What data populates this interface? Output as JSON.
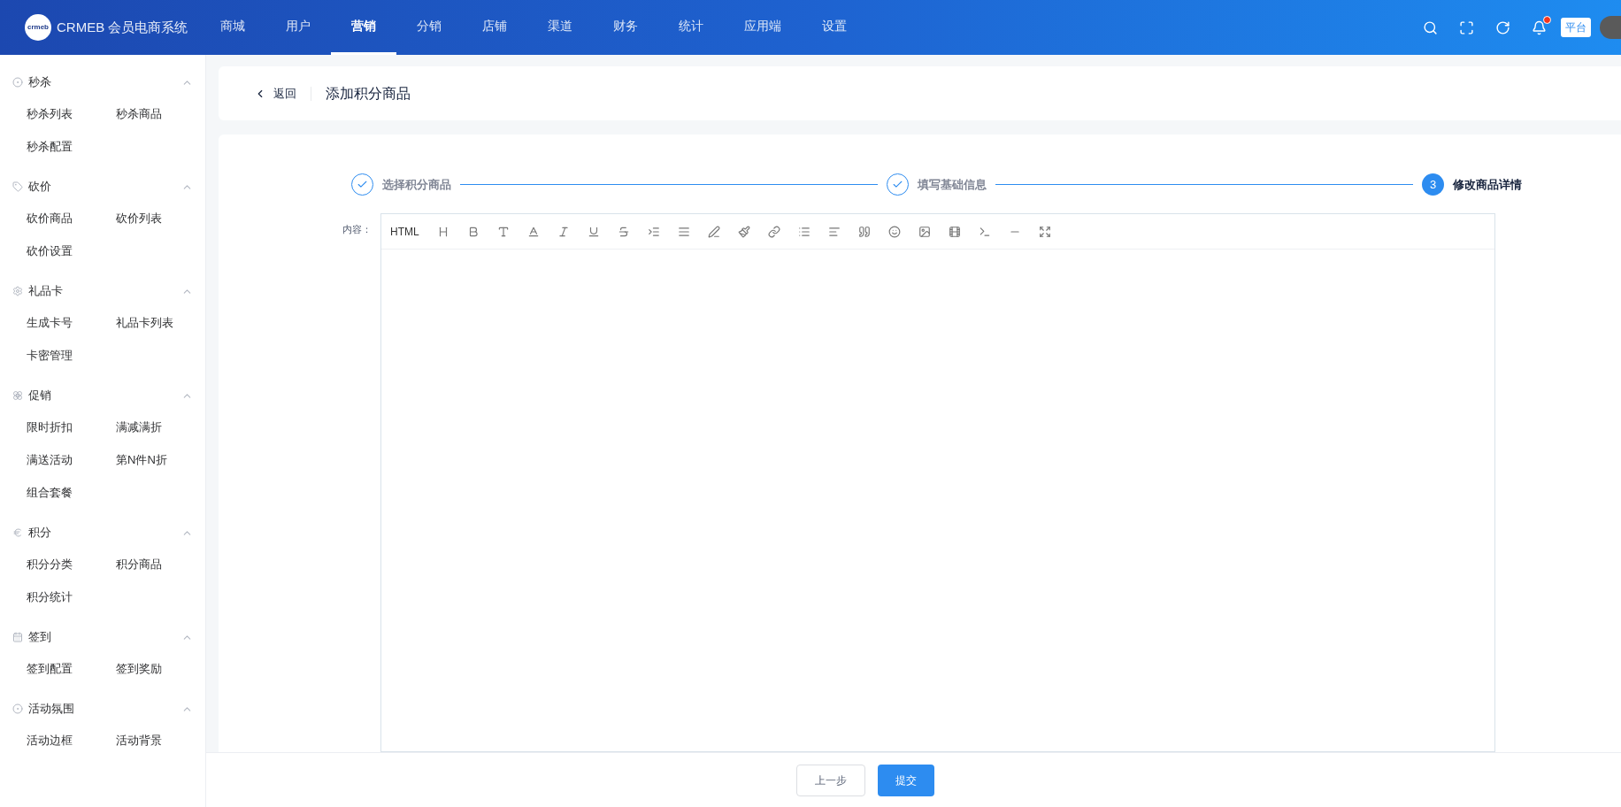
{
  "header": {
    "brand": "CRMEB 会员电商系统",
    "logo_text": "crmeb",
    "nav": [
      {
        "label": "商城",
        "selected": false
      },
      {
        "label": "用户",
        "selected": false
      },
      {
        "label": "营销",
        "selected": true
      },
      {
        "label": "分销",
        "selected": false
      },
      {
        "label": "店铺",
        "selected": false
      },
      {
        "label": "渠道",
        "selected": false
      },
      {
        "label": "财务",
        "selected": false
      },
      {
        "label": "统计",
        "selected": false
      },
      {
        "label": "应用端",
        "selected": false
      },
      {
        "label": "设置",
        "selected": false
      }
    ],
    "has_unread": true,
    "platform_badge": "平台"
  },
  "sidebar": {
    "groups": [
      {
        "title": "秒杀",
        "expanded": true,
        "items": [
          "秒杀列表",
          "秒杀商品",
          "秒杀配置"
        ]
      },
      {
        "title": "砍价",
        "expanded": true,
        "items": [
          "砍价商品",
          "砍价列表",
          "砍价设置"
        ]
      },
      {
        "title": "礼品卡",
        "expanded": true,
        "items": [
          "生成卡号",
          "礼品卡列表",
          "卡密管理"
        ]
      },
      {
        "title": "促销",
        "expanded": true,
        "items": [
          "限时折扣",
          "满减满折",
          "满送活动",
          "第N件N折",
          "组合套餐"
        ]
      },
      {
        "title": "积分",
        "expanded": true,
        "items": [
          "积分分类",
          "积分商品",
          "积分统计"
        ]
      },
      {
        "title": "签到",
        "expanded": true,
        "items": [
          "签到配置",
          "签到奖励"
        ]
      },
      {
        "title": "活动氛围",
        "expanded": true,
        "items": [
          "活动边框",
          "活动背景"
        ]
      }
    ]
  },
  "page_header": {
    "back": "返回",
    "title": "添加积分商品"
  },
  "steps": [
    {
      "label": "选择积分商品",
      "done": true
    },
    {
      "label": "填写基础信息",
      "done": true
    },
    {
      "label": "修改商品详情",
      "done": false,
      "number": "3"
    }
  ],
  "editor": {
    "label": "内容：",
    "html_button": "HTML"
  },
  "footer": {
    "buttons": [
      {
        "label": "上一步",
        "kind": "default"
      },
      {
        "label": "提交",
        "kind": "primary"
      }
    ]
  }
}
